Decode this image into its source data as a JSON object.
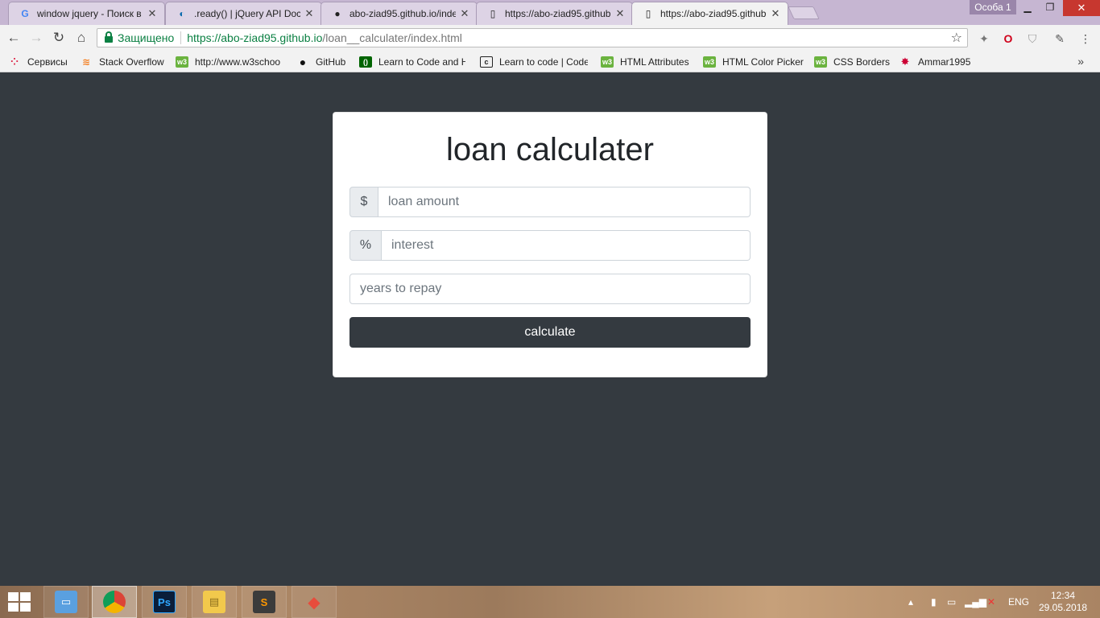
{
  "browser": {
    "tabs": [
      {
        "title": "window jquery - Поиск в",
        "icon": "google-icon"
      },
      {
        "title": ".ready() | jQuery API Docu",
        "icon": "jquery-icon"
      },
      {
        "title": "abo-ziad95.github.io/inde",
        "icon": "github-icon"
      },
      {
        "title": "https://abo-ziad95.github",
        "icon": "page-icon"
      },
      {
        "title": "https://abo-ziad95.github",
        "icon": "page-icon"
      }
    ],
    "profile": "Особа 1",
    "address": {
      "secure_label": "Защищено",
      "url_host": "https://abo-ziad95.github.io",
      "url_path": "/loan__calculater/index.html"
    },
    "bookmarks": [
      {
        "label": "Сервисы",
        "icon": "apps-icon"
      },
      {
        "label": "Stack Overflow",
        "icon": "stackoverflow-icon"
      },
      {
        "label": "http://www.w3schoo",
        "icon": "w3schools-icon"
      },
      {
        "label": "GitHub",
        "icon": "github-icon"
      },
      {
        "label": "Learn to Code and H",
        "icon": "freecodecamp-icon"
      },
      {
        "label": "Learn to code | Code",
        "icon": "codecademy-icon"
      },
      {
        "label": "HTML Attributes",
        "icon": "w3schools-icon"
      },
      {
        "label": "HTML Color Picker",
        "icon": "w3schools-icon"
      },
      {
        "label": "CSS Borders",
        "icon": "w3schools-icon"
      },
      {
        "label": "Ammar1995",
        "icon": "star-icon"
      }
    ]
  },
  "page": {
    "title": "loan calculater",
    "amount_addon": "$",
    "amount_placeholder": "loan amount",
    "interest_addon": "%",
    "interest_placeholder": "interest",
    "years_placeholder": "years to repay",
    "button_label": "calculate"
  },
  "taskbar": {
    "apps": [
      "explorer",
      "chrome",
      "photoshop",
      "file-manager",
      "sublime-text",
      "git-client"
    ],
    "language": "ENG",
    "time": "12:34",
    "date": "29.05.2018"
  },
  "colors": {
    "page_bg": "#343a40",
    "card_bg": "#ffffff",
    "button_bg": "#343a40",
    "secure_green": "#0b8043"
  }
}
